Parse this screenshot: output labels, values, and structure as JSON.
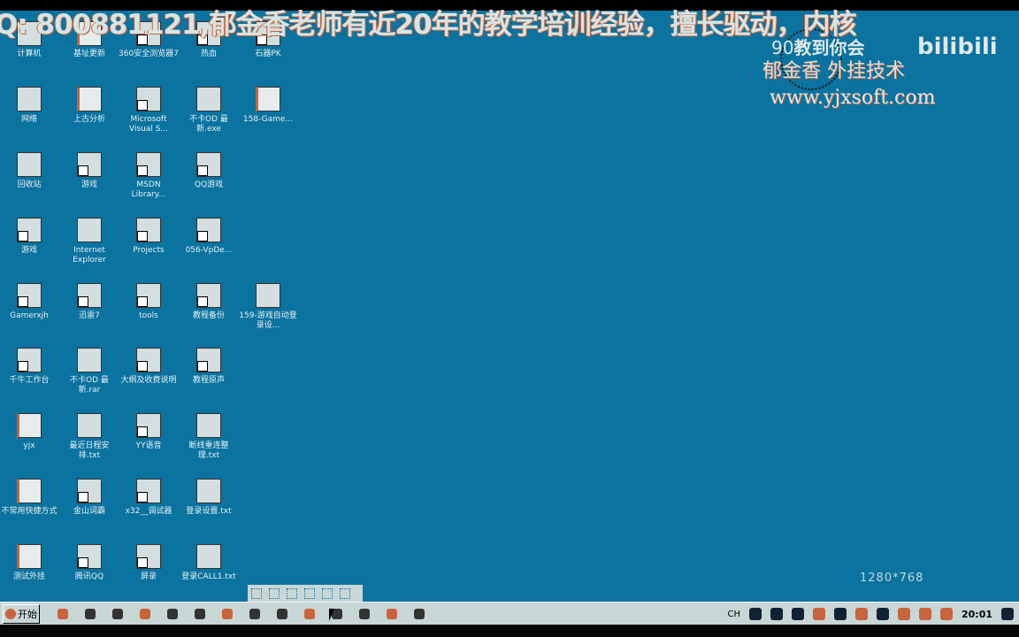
{
  "overlay": {
    "banner": "Q: 800881121,郁金香老师有近20年的教学培训经验，擅长驱动，内核",
    "logo_line1": "教到你会",
    "logo_num": "90",
    "logo_brand": "bilibili",
    "logo_line2": "郁金香 外挂技术",
    "logo_url": "www.yjxsoft.com"
  },
  "resolution": "1280*768",
  "desktop_icons": [
    [
      {
        "label": "计算机",
        "type": "app"
      },
      {
        "label": "基址更新",
        "type": "folder"
      },
      {
        "label": "360安全浏览器7",
        "type": "shortcut"
      },
      {
        "label": "热血",
        "type": "shortcut"
      },
      {
        "label": "石器PK",
        "type": "shortcut"
      }
    ],
    [
      {
        "label": "网络",
        "type": "app"
      },
      {
        "label": "上古分析",
        "type": "folder"
      },
      {
        "label": "Microsoft Visual S...",
        "type": "shortcut"
      },
      {
        "label": "不卡OD 最新.exe",
        "type": "app"
      },
      {
        "label": "158-Game...",
        "type": "folder"
      }
    ],
    [
      {
        "label": "回收站",
        "type": "app"
      },
      {
        "label": "游戏",
        "type": "shortcut"
      },
      {
        "label": "MSDN Library...",
        "type": "shortcut"
      },
      {
        "label": "QQ游戏",
        "type": "shortcut"
      }
    ],
    [
      {
        "label": "游戏",
        "type": "shortcut"
      },
      {
        "label": "Internet Explorer",
        "type": "app"
      },
      {
        "label": "Projects",
        "type": "shortcut"
      },
      {
        "label": "056-VpDe...",
        "type": "shortcut"
      }
    ],
    [
      {
        "label": "Gamerxjh",
        "type": "shortcut"
      },
      {
        "label": "迅雷7",
        "type": "shortcut"
      },
      {
        "label": "tools",
        "type": "shortcut"
      },
      {
        "label": "教程备份",
        "type": "shortcut"
      },
      {
        "label": "159-游戏自动登录设...",
        "type": "file"
      }
    ],
    [
      {
        "label": "千牛工作台",
        "type": "shortcut"
      },
      {
        "label": "不卡OD 最新.rar",
        "type": "file"
      },
      {
        "label": "大纲及收费说明",
        "type": "shortcut"
      },
      {
        "label": "教程原声",
        "type": "shortcut"
      }
    ],
    [
      {
        "label": "yjx",
        "type": "folder"
      },
      {
        "label": "最近日程安排.txt",
        "type": "file"
      },
      {
        "label": "YY语音",
        "type": "shortcut"
      },
      {
        "label": "断线重连整理.txt",
        "type": "file"
      }
    ],
    [
      {
        "label": "不常用快捷方式",
        "type": "folder"
      },
      {
        "label": "金山词霸",
        "type": "shortcut"
      },
      {
        "label": "x32__调试器",
        "type": "shortcut"
      },
      {
        "label": "登录设置.txt",
        "type": "file"
      }
    ],
    [
      {
        "label": "测试外挂",
        "type": "folder"
      },
      {
        "label": "腾讯QQ",
        "type": "shortcut"
      },
      {
        "label": "屏录",
        "type": "shortcut"
      },
      {
        "label": "登录CALL1.txt",
        "type": "file"
      }
    ]
  ],
  "taskbar": {
    "start_label": "开始",
    "clock": "20:01",
    "ime": "CH",
    "buttons": [
      "app",
      "app",
      "app",
      "folder",
      "app",
      "app",
      "app",
      "app",
      "app",
      "app",
      "app",
      "app",
      "app",
      "app"
    ]
  },
  "colors": {
    "desktop": "#0a73a0",
    "taskbar": "#c8d6d6",
    "accent": "#c8643c"
  }
}
